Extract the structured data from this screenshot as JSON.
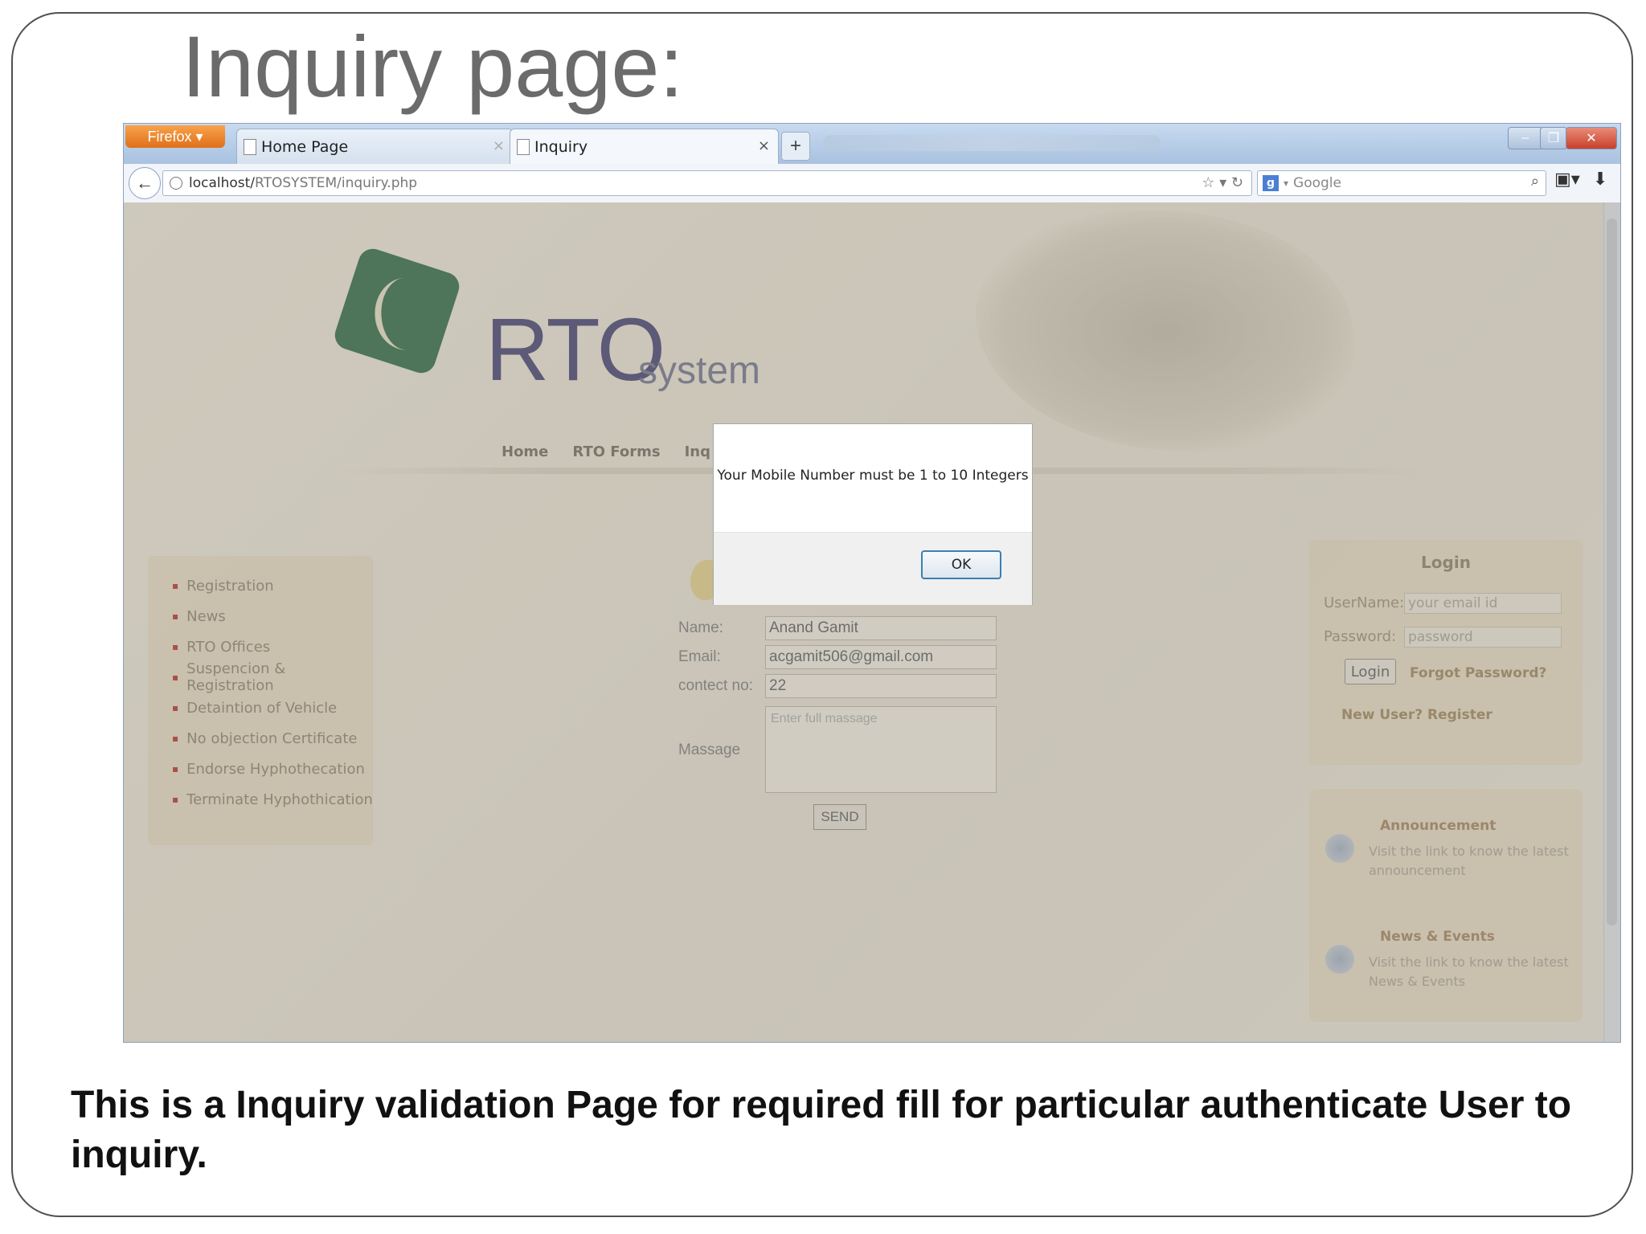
{
  "slide": {
    "title": "Inquiry page:",
    "caption": "This is a Inquiry validation Page for required fill for particular authenticate User to inquiry."
  },
  "browser": {
    "app_button": "Firefox",
    "tabs": [
      {
        "label": "Home Page",
        "active": false
      },
      {
        "label": "Inquiry",
        "active": true
      }
    ],
    "url_host": "localhost/",
    "url_path": "RTOSYSTEM/inquiry.php",
    "search_placeholder": "Google"
  },
  "site": {
    "logo_text": "RTO",
    "logo_sub": "system",
    "menu": [
      "Home",
      "RTO Forms",
      "Inq"
    ],
    "left_menu": [
      "Registration",
      "News",
      "RTO Offices",
      "Suspencion & Registration",
      "Detaintion of Vehicle",
      "No objection Certificate",
      "Endorse Hyphothecation",
      "Terminate Hyphothication"
    ],
    "form": {
      "name_label": "Name:",
      "name_value": "Anand Gamit",
      "email_label": "Email:",
      "email_value": "acgamit506@gmail.com",
      "contact_label": "contect no:",
      "contact_value": "22",
      "message_label": "Massage",
      "message_placeholder": "Enter full massage",
      "send_label": "SEND"
    },
    "login": {
      "title": "Login",
      "username_label": "UserName:",
      "username_placeholder": "your email id",
      "password_label": "Password:",
      "password_placeholder": "password",
      "login_button": "Login",
      "forgot_link": "Forgot Password?",
      "register_link": "New User? Register"
    },
    "announcements": [
      {
        "title": "Announcement",
        "text": "Visit the link to know the latest announcement"
      },
      {
        "title": "News & Events",
        "text": "Visit the link to know the latest News & Events"
      }
    ]
  },
  "alert": {
    "message": "Your Mobile Number must be 1 to 10 Integers",
    "ok_label": "OK"
  },
  "colors": {
    "logo_green": "#22623a",
    "logo_text": "#3a376d",
    "alert_button_border": "#3c7fb1",
    "firefox_orange": "#e0701a"
  }
}
